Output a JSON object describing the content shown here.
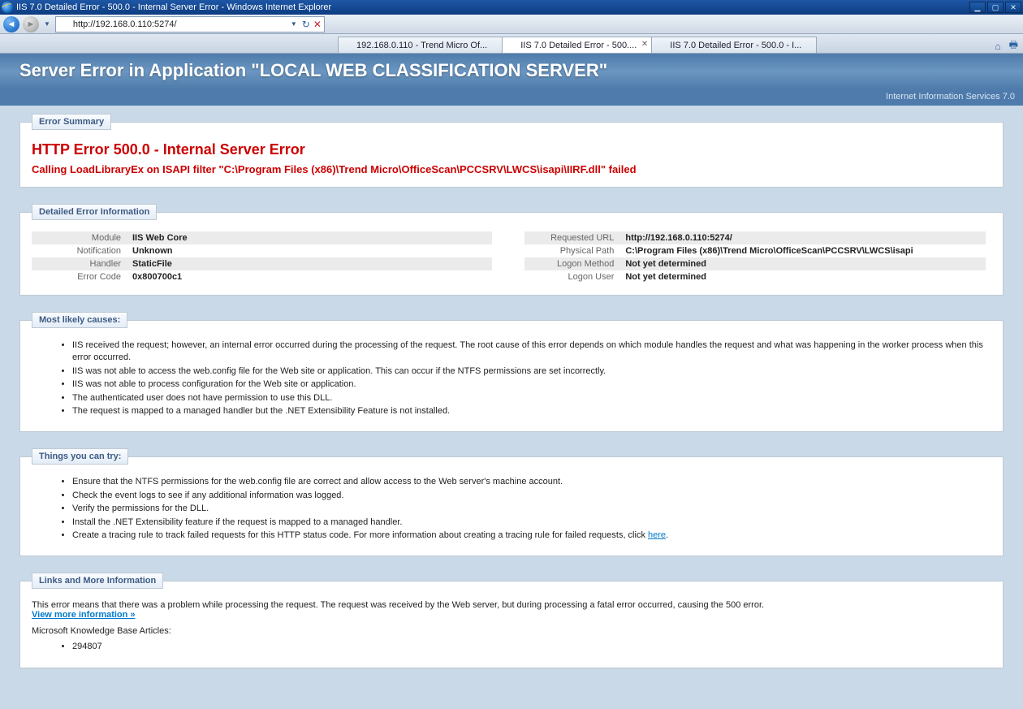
{
  "window": {
    "title": "IIS 7.0 Detailed Error - 500.0 - Internal Server Error - Windows Internet Explorer"
  },
  "address_bar": {
    "url": "http://192.168.0.110:5274/"
  },
  "tabs": {
    "items": [
      {
        "label": "192.168.0.110 - Trend Micro Of..."
      },
      {
        "label": "IIS 7.0 Detailed Error - 500....",
        "active": true
      },
      {
        "label": "IIS 7.0 Detailed Error - 500.0 - I..."
      }
    ]
  },
  "banner": {
    "title": "Server Error in Application \"LOCAL WEB CLASSIFICATION SERVER\"",
    "subtitle": "Internet Information Services 7.0"
  },
  "error_summary": {
    "legend": "Error Summary",
    "title": "HTTP Error 500.0 - Internal Server Error",
    "subtitle": "Calling LoadLibraryEx on ISAPI filter \"C:\\Program Files (x86)\\Trend Micro\\OfficeScan\\PCCSRV\\LWCS\\isapi\\IIRF.dll\" failed"
  },
  "detailed": {
    "legend": "Detailed Error Information",
    "left": [
      {
        "k": "Module",
        "v": "IIS Web Core"
      },
      {
        "k": "Notification",
        "v": "Unknown"
      },
      {
        "k": "Handler",
        "v": "StaticFile"
      },
      {
        "k": "Error Code",
        "v": "0x800700c1"
      }
    ],
    "right": [
      {
        "k": "Requested URL",
        "v": "http://192.168.0.110:5274/"
      },
      {
        "k": "Physical Path",
        "v": "C:\\Program Files (x86)\\Trend Micro\\OfficeScan\\PCCSRV\\LWCS\\isapi"
      },
      {
        "k": "Logon Method",
        "v": "Not yet determined"
      },
      {
        "k": "Logon User",
        "v": "Not yet determined"
      }
    ]
  },
  "causes": {
    "legend": "Most likely causes:",
    "items": [
      "IIS received the request; however, an internal error occurred during the processing of the request. The root cause of this error depends on which module handles the request and what was happening in the worker process when this error occurred.",
      "IIS was not able to access the web.config file for the Web site or application. This can occur if the NTFS permissions are set incorrectly.",
      "IIS was not able to process configuration for the Web site or application.",
      "The authenticated user does not have permission to use this DLL.",
      "The request is mapped to a managed handler but the .NET Extensibility Feature is not installed."
    ]
  },
  "try": {
    "legend": "Things you can try:",
    "items": [
      "Ensure that the NTFS permissions for the web.config file are correct and allow access to the Web server's machine account.",
      "Check the event logs to see if any additional information was logged.",
      "Verify the permissions for the DLL.",
      "Install the .NET Extensibility feature if the request is mapped to a managed handler."
    ],
    "last_prefix": "Create a tracing rule to track failed requests for this HTTP status code. For more information about creating a tracing rule for failed requests, click ",
    "last_link": "here",
    "last_suffix": "."
  },
  "links": {
    "legend": "Links and More Information",
    "para": "This error means that there was a problem while processing the request. The request was received by the Web server, but during processing a fatal error occurred, causing the 500 error.",
    "more": "View more information »",
    "kb_head": "Microsoft Knowledge Base Articles:",
    "kb_items": [
      "294807"
    ]
  }
}
